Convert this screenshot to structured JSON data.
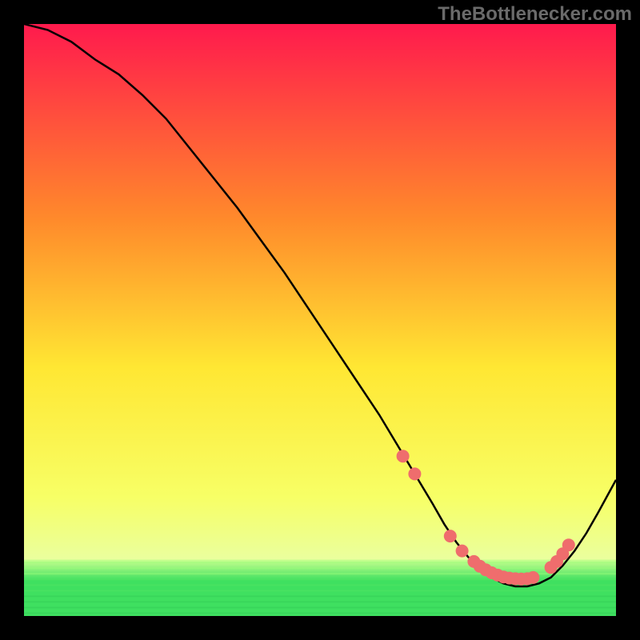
{
  "watermark": "TheBottleneсker.com",
  "chart_data": {
    "type": "line",
    "title": "",
    "xlabel": "",
    "ylabel": "",
    "xlim": [
      0,
      100
    ],
    "ylim": [
      0,
      100
    ],
    "background_gradient": {
      "top": "#ff1a4d",
      "upper_mid": "#ff8a2b",
      "mid": "#ffe733",
      "lower_mid": "#f7ff66",
      "green_band_top": "#c9ff8f",
      "green_band_mid": "#3fe060",
      "green_band_bottom": "#3fe060"
    },
    "series": [
      {
        "name": "bottleneck-curve",
        "color": "#000000",
        "x": [
          0,
          4,
          8,
          12,
          16,
          20,
          24,
          28,
          32,
          36,
          40,
          44,
          48,
          52,
          56,
          60,
          63,
          66,
          69,
          71,
          73,
          75,
          77,
          79,
          81,
          83,
          85,
          87,
          89,
          91,
          93,
          95,
          97,
          100
        ],
        "y": [
          100,
          99,
          97,
          94,
          91.5,
          88,
          84,
          79,
          74,
          69,
          63.5,
          58,
          52,
          46,
          40,
          34,
          29,
          24,
          19,
          15.5,
          12.5,
          10,
          8,
          6.5,
          5.5,
          5,
          5,
          5.5,
          6.5,
          8.5,
          11,
          14,
          17.5,
          23
        ]
      }
    ],
    "markers": {
      "name": "highlight-dots",
      "color": "#ef6d6d",
      "radius_px": 8,
      "x": [
        64,
        66,
        72,
        74,
        76,
        77,
        78,
        79,
        80,
        81,
        82,
        83,
        84,
        85,
        86,
        89,
        90,
        91,
        92
      ],
      "y": [
        27,
        24,
        13.5,
        11,
        9.2,
        8.4,
        7.8,
        7.3,
        6.9,
        6.6,
        6.4,
        6.3,
        6.25,
        6.3,
        6.5,
        8.2,
        9.2,
        10.5,
        12
      ]
    }
  }
}
